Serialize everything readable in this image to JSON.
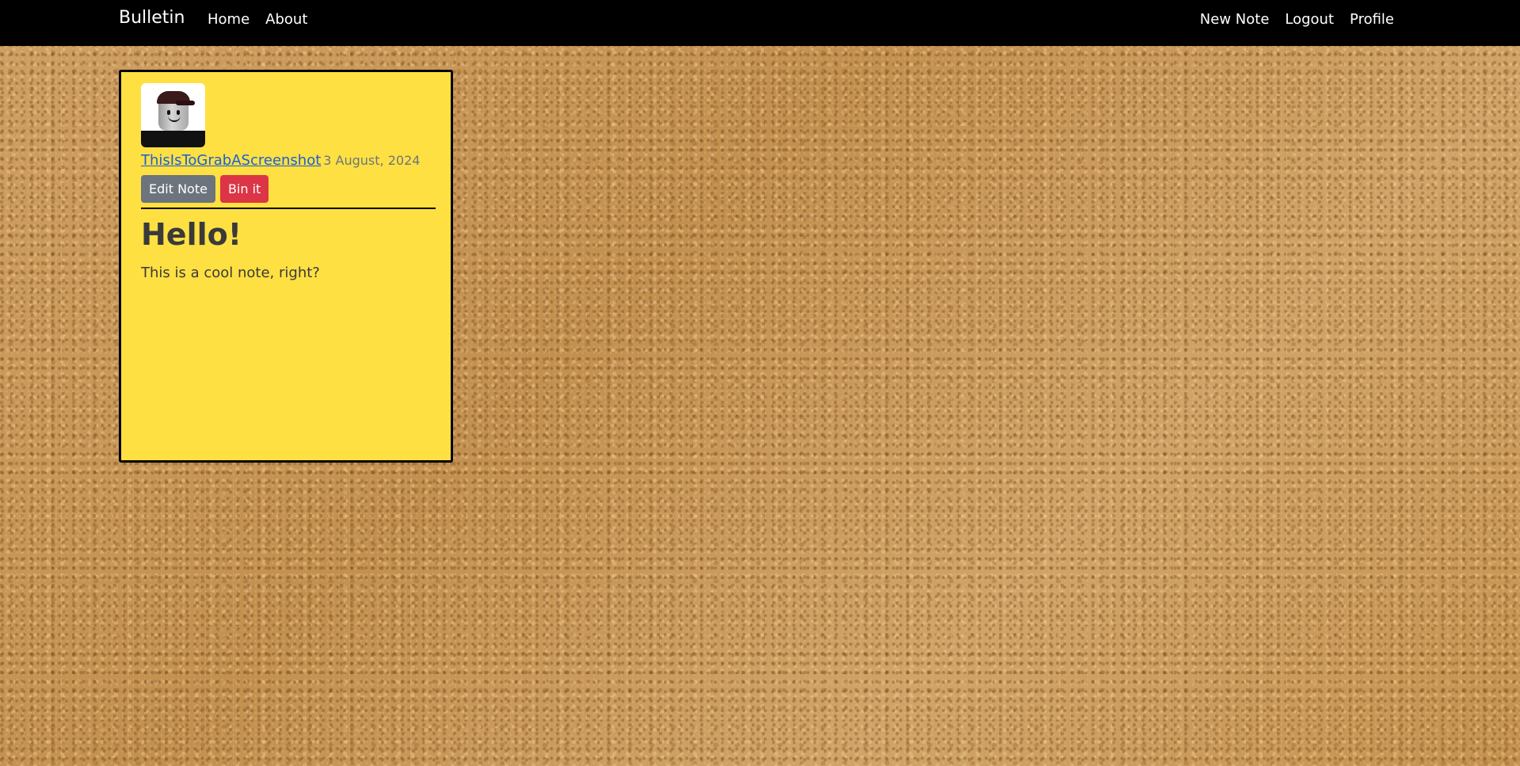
{
  "navbar": {
    "brand": "Bulletin",
    "left_links": [
      "Home",
      "About"
    ],
    "right_links": [
      "New Note",
      "Logout",
      "Profile"
    ]
  },
  "note": {
    "username": "ThisIsToGrabAScreenshot",
    "date": "3 August, 2024",
    "edit_label": "Edit Note",
    "bin_label": "Bin it",
    "title": "Hello!",
    "body": "This is a cool note, right?"
  },
  "colors": {
    "navbar": "#000000",
    "note_background": "#ffe042",
    "link": "#1a5fd6",
    "edit_button": "#6c757d",
    "bin_button": "#dc3545"
  },
  "icons": {
    "avatar": "avatar-image"
  }
}
